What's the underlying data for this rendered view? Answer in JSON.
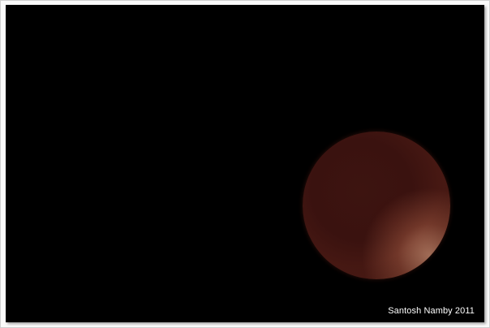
{
  "photo": {
    "subject": "eclipsed-moon",
    "credit_text": "Santosh Namby 2011",
    "background_color": "#000000",
    "moon_color": "#4a1a14",
    "credit_color": "#ffffff"
  }
}
